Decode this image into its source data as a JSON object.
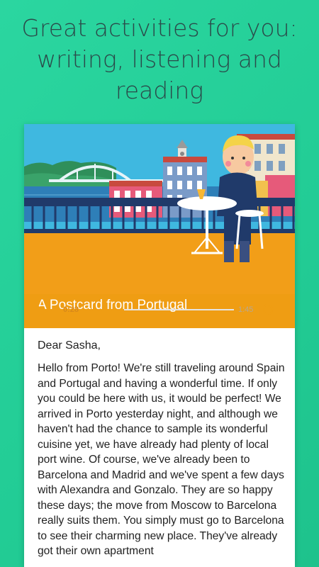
{
  "headline": {
    "line1": "Great activities for you:",
    "line2": "writing, listening and",
    "line3": "reading"
  },
  "lesson": {
    "title": "A Postcard from Portugal",
    "illustration_icon": "postcard-scene-illustration"
  },
  "player": {
    "current_time": "0:28",
    "total_time": "1:45",
    "progress": 0.267,
    "play_icon": "play-icon",
    "replay_icon": "replay-icon"
  },
  "letter": {
    "greeting": "Dear Sasha,",
    "body": "Hello from Porto! We're still traveling around Spain and Portugal and having a wonderful time. If only you could be here with us, it would be perfect! We arrived in Porto yesterday night, and although we haven't had the chance to sample its wonderful cuisine yet, we have already had plenty of local port wine. Of course, we've already been to Barcelona and Madrid and we've spent a few days with Alexandra and Gonzalo. They are so happy these days; the move from Moscow to Barcelona really suits them. You simply must go to Barcelona to see their charming new place. They've already got their own apartment"
  },
  "colors": {
    "background": "#22cc95",
    "accent": "#ef9d13",
    "headline_text": "#2b4a4a"
  }
}
